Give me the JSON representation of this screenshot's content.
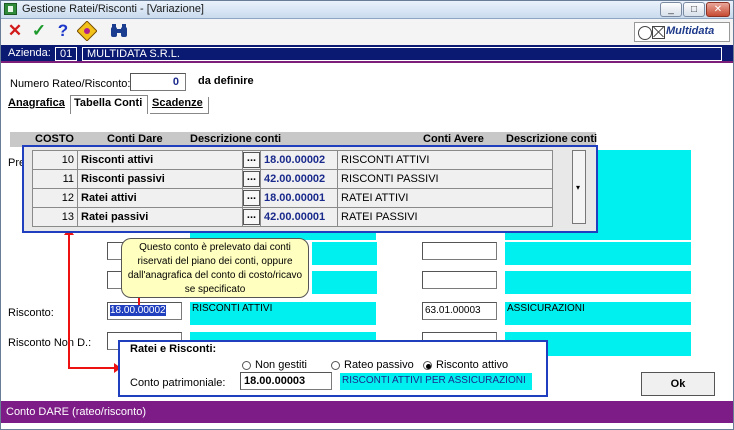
{
  "window": {
    "title": "Gestione Ratei/Risconti - [Variazione]",
    "min": "_",
    "max": "□",
    "close": "✕"
  },
  "toolbar": {
    "brand": "Multidata"
  },
  "azienda": {
    "label": "Azienda:",
    "code": "01",
    "name": "MULTIDATA S.R.L."
  },
  "numero": {
    "label": "Numero Rateo/Risconto:",
    "value": "0",
    "status": "da definire"
  },
  "tabs": [
    {
      "label": "Anagrafica"
    },
    {
      "label": "Tabella Conti"
    },
    {
      "label": "Scadenze"
    }
  ],
  "grid_header": {
    "costo": "COSTO",
    "conti_dare": "Conti Dare",
    "descrizione_dare": "Descrizione conti",
    "conti_avere": "Conti Avere",
    "descrizione_avere": "Descrizione conti"
  },
  "popup_rows": [
    {
      "num": "10",
      "desc": "Risconti attivi",
      "btn": "...",
      "account": "18.00.00002",
      "account_desc": "RISCONTI ATTIVI"
    },
    {
      "num": "11",
      "desc": "Risconti passivi",
      "btn": "...",
      "account": "42.00.00002",
      "account_desc": "RISCONTI PASSIVI"
    },
    {
      "num": "12",
      "desc": "Ratei attivi",
      "btn": "...",
      "account": "18.00.00001",
      "account_desc": "RATEI ATTIVI"
    },
    {
      "num": "13",
      "desc": "Ratei passivi",
      "btn": "...",
      "account": "42.00.00001",
      "account_desc": "RATEI PASSIVI"
    }
  ],
  "left_partial_label": "Pre",
  "tooltip": {
    "text": "Questo conto è prelevato dai conti riservati del piano dei conti, oppure dall'anagrafica del conto di costo/ricavo se specificato"
  },
  "risconto": {
    "label": "Risconto:",
    "dare_account": "18.00.00002",
    "dare_desc": "RISCONTI ATTIVI",
    "avere_account": "63.01.00003",
    "avere_desc": "ASSICURAZIONI"
  },
  "risconto_nond": {
    "label": "Risconto Non D.:"
  },
  "ratei_risconti": {
    "title": "Ratei e Risconti:",
    "options": [
      {
        "label": "Non gestiti",
        "selected": false
      },
      {
        "label": "Rateo passivo",
        "selected": false
      },
      {
        "label": "Risconto attivo",
        "selected": true
      }
    ],
    "conto_label": "Conto patrimoniale:",
    "conto_value": "18.00.00003",
    "conto_desc": "RISCONTI ATTIVI PER ASSICURAZIONI"
  },
  "ok_button": "Ok",
  "status": "Conto DARE (rateo/risconto)",
  "colors": {
    "accent": "#0a1a73",
    "status": "#7d1b87",
    "cyan": "#00f0f0",
    "highlight": "#1f3fbf"
  }
}
